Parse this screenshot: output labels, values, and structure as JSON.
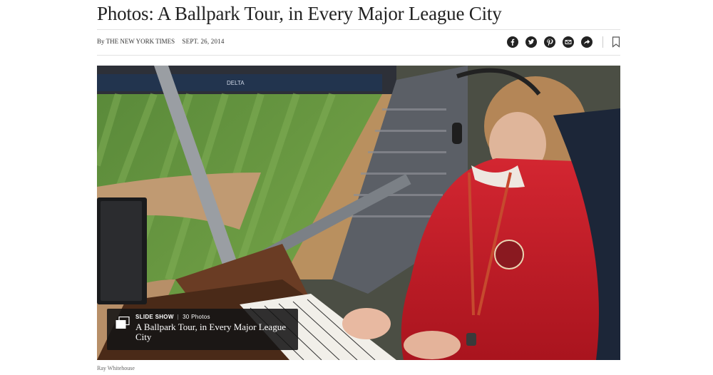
{
  "article": {
    "headline": "Photos: A Ballpark Tour, in Every Major League City",
    "byline": "By THE NEW YORK TIMES",
    "date": "SEPT. 26, 2014"
  },
  "share": {
    "icons": [
      "facebook-icon",
      "twitter-icon",
      "pinterest-icon",
      "email-icon",
      "share-icon",
      "bookmark-icon"
    ]
  },
  "slideshow": {
    "kicker": "SLIDE SHOW",
    "count": "30 Photos",
    "title": "A Ballpark Tour, in Every Major League City"
  },
  "photo": {
    "credit": "Ray Whitehouse",
    "sign_text": "DELTA"
  }
}
